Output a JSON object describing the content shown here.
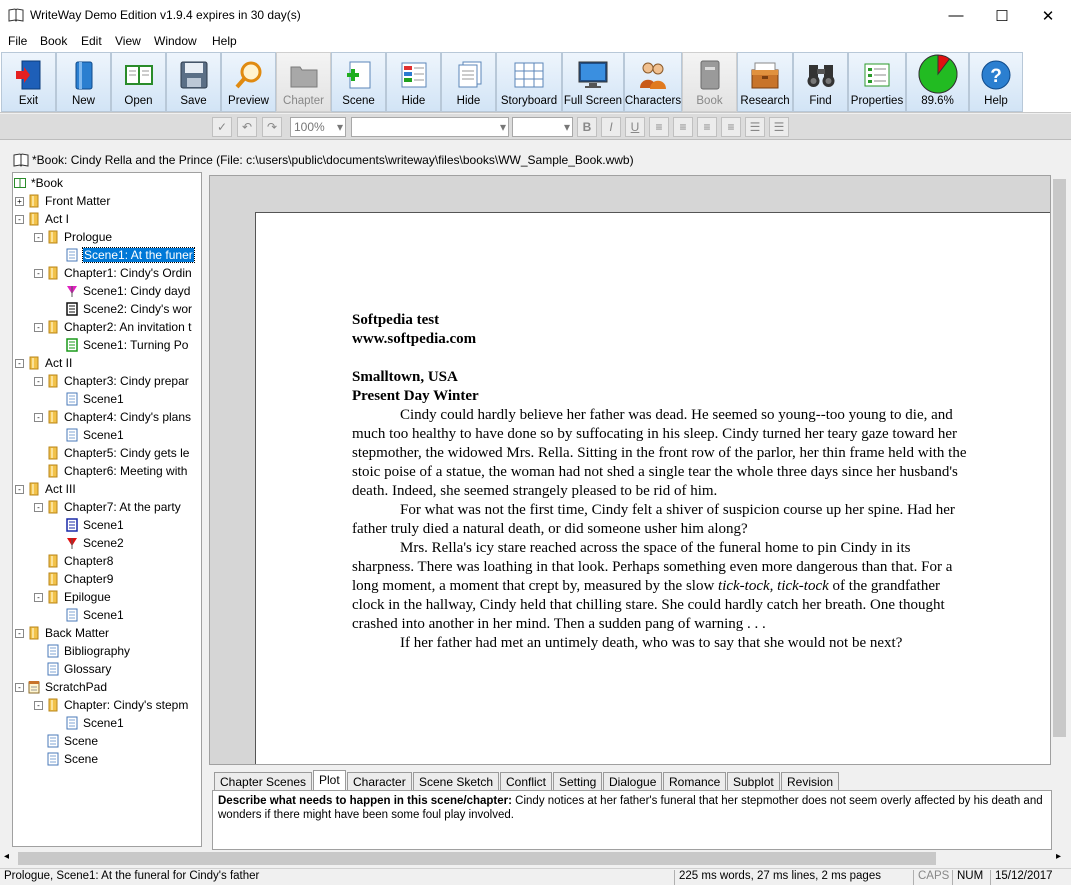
{
  "window": {
    "title": "WriteWay Demo Edition v1.9.4  expires in 30 day(s)",
    "min_glyph": "—",
    "max_glyph": "☐",
    "close_glyph": "✕"
  },
  "menu": [
    "File",
    "Book",
    "Edit",
    "View",
    "Window",
    "Help"
  ],
  "toolbar": [
    {
      "label": "Exit",
      "icon": "exit-door-icon",
      "enabled": true
    },
    {
      "label": "New",
      "icon": "new-book-icon",
      "enabled": true
    },
    {
      "label": "Open",
      "icon": "open-book-icon",
      "enabled": true
    },
    {
      "label": "Save",
      "icon": "floppy-disk-icon",
      "enabled": true
    },
    {
      "label": "Preview",
      "icon": "magnifier-icon",
      "enabled": true
    },
    {
      "label": "Chapter",
      "icon": "folder-icon",
      "enabled": false
    },
    {
      "label": "Scene",
      "icon": "add-scene-icon",
      "enabled": true
    },
    {
      "label": "Hide",
      "icon": "hide-panel-icon",
      "enabled": true
    },
    {
      "label": "Hide",
      "icon": "hide-pages-icon",
      "enabled": true
    },
    {
      "label": "Storyboard",
      "icon": "storyboard-grid-icon",
      "enabled": true
    },
    {
      "label": "Full Screen",
      "icon": "monitor-icon",
      "enabled": true
    },
    {
      "label": "Characters",
      "icon": "people-icon",
      "enabled": true
    },
    {
      "label": "Book",
      "icon": "book-icon",
      "enabled": false
    },
    {
      "label": "Research",
      "icon": "research-box-icon",
      "enabled": true
    },
    {
      "label": "Find",
      "icon": "binoculars-icon",
      "enabled": true
    },
    {
      "label": "Properties",
      "icon": "properties-icon",
      "enabled": true
    },
    {
      "label": "89.6%",
      "icon": "progress-pie-icon",
      "enabled": true
    },
    {
      "label": "Help",
      "icon": "help-icon",
      "enabled": true
    }
  ],
  "progress_fraction": 0.896,
  "colors": {
    "progress_done": "#22bb22",
    "progress_rest": "#e01010",
    "selection": "#0078d7"
  },
  "format": {
    "zoom": "100%",
    "font": "",
    "size": "",
    "bold": "B",
    "italic": "I",
    "underline": "U"
  },
  "doc_title": "*Book: Cindy Rella and the Prince (File: c:\\users\\public\\documents\\writeway\\files\\books\\WW_Sample_Book.wwb)",
  "tree": [
    {
      "label": "*Book",
      "depth": 0,
      "icon": "book",
      "exp": ""
    },
    {
      "label": "Front Matter",
      "depth": 1,
      "icon": "folder",
      "exp": "+"
    },
    {
      "label": "Act I",
      "depth": 1,
      "icon": "folder",
      "exp": "-"
    },
    {
      "label": "Prologue",
      "depth": 2,
      "icon": "folder",
      "exp": "-"
    },
    {
      "label": "Scene1: At the funer",
      "depth": 3,
      "icon": "doc",
      "exp": "",
      "selected": true
    },
    {
      "label": "Chapter1: Cindy's Ordin",
      "depth": 2,
      "icon": "folder",
      "exp": "-"
    },
    {
      "label": "Scene1: Cindy dayd",
      "depth": 3,
      "icon": "flag-magenta",
      "exp": ""
    },
    {
      "label": "Scene2: Cindy's wor",
      "depth": 3,
      "icon": "doc-dark",
      "exp": ""
    },
    {
      "label": "Chapter2: An invitation t",
      "depth": 2,
      "icon": "folder",
      "exp": "-"
    },
    {
      "label": "Scene1: Turning Po",
      "depth": 3,
      "icon": "doc-green",
      "exp": ""
    },
    {
      "label": "Act II",
      "depth": 1,
      "icon": "folder",
      "exp": "-"
    },
    {
      "label": "Chapter3: Cindy prepar",
      "depth": 2,
      "icon": "folder",
      "exp": "-"
    },
    {
      "label": "Scene1",
      "depth": 3,
      "icon": "doc",
      "exp": ""
    },
    {
      "label": "Chapter4: Cindy's plans",
      "depth": 2,
      "icon": "folder",
      "exp": "-"
    },
    {
      "label": "Scene1",
      "depth": 3,
      "icon": "doc",
      "exp": ""
    },
    {
      "label": "Chapter5: Cindy gets le",
      "depth": 2,
      "icon": "folder",
      "exp": ""
    },
    {
      "label": "Chapter6: Meeting with",
      "depth": 2,
      "icon": "folder",
      "exp": ""
    },
    {
      "label": "Act III",
      "depth": 1,
      "icon": "folder",
      "exp": "-"
    },
    {
      "label": "Chapter7: At the party",
      "depth": 2,
      "icon": "folder",
      "exp": "-"
    },
    {
      "label": "Scene1",
      "depth": 3,
      "icon": "doc-blue",
      "exp": ""
    },
    {
      "label": "Scene2",
      "depth": 3,
      "icon": "flag-red",
      "exp": ""
    },
    {
      "label": "Chapter8",
      "depth": 2,
      "icon": "folder",
      "exp": ""
    },
    {
      "label": "Chapter9",
      "depth": 2,
      "icon": "folder",
      "exp": ""
    },
    {
      "label": "Epilogue",
      "depth": 2,
      "icon": "folder",
      "exp": "-"
    },
    {
      "label": "Scene1",
      "depth": 3,
      "icon": "doc",
      "exp": ""
    },
    {
      "label": "Back Matter",
      "depth": 1,
      "icon": "folder",
      "exp": "-"
    },
    {
      "label": "Bibliography",
      "depth": 2,
      "icon": "doc",
      "exp": ""
    },
    {
      "label": "Glossary",
      "depth": 2,
      "icon": "doc",
      "exp": ""
    },
    {
      "label": "ScratchPad",
      "depth": 1,
      "icon": "notepad",
      "exp": "-"
    },
    {
      "label": "Chapter: Cindy's stepm",
      "depth": 2,
      "icon": "folder",
      "exp": "-"
    },
    {
      "label": "Scene1",
      "depth": 3,
      "icon": "doc",
      "exp": ""
    },
    {
      "label": "Scene",
      "depth": 2,
      "icon": "doc",
      "exp": ""
    },
    {
      "label": "Scene",
      "depth": 2,
      "icon": "doc",
      "exp": ""
    }
  ],
  "document": {
    "heading1": "Softpedia test",
    "heading2": "www.softpedia.com",
    "heading3": "Smalltown, USA",
    "heading4": "Present Day Winter",
    "p1": "Cindy could hardly believe her father was dead. He seemed so young--too young to die, and much too healthy to have done so by suffocating in his sleep. Cindy turned her teary gaze toward her stepmother, the widowed Mrs. Rella. Sitting in the front row of the parlor, her thin frame held with the stoic poise of a statue, the woman had not shed a single tear the whole three days since her husband's death. Indeed, she seemed strangely pleased to be rid of him.",
    "p2": "For what was not the first time, Cindy felt a shiver of suspicion course up her spine. Had her father truly died a natural death, or did someone usher him along?",
    "p3a": "Mrs. Rella's icy stare reached across the space of the funeral home to pin Cindy in its sharpness. There was loathing in that look. Perhaps something even more dangerous than that. For a long moment, a moment that crept by, measured by the slow ",
    "p3i": "tick-tock, tick-tock",
    "p3b": " of the grandfather clock in the hallway, Cindy held that chilling stare. She could hardly catch her breath. One thought crashed into another in her mind. Then a sudden pang of warning . . .",
    "p4": "If her father had met an untimely death, who was to say that she would not be next?"
  },
  "tabs": [
    "Chapter Scenes",
    "Plot",
    "Character",
    "Scene Sketch",
    "Conflict",
    "Setting",
    "Dialogue",
    "Romance",
    "Subplot",
    "Revision"
  ],
  "notes": {
    "label": "Describe what needs to happen in this scene/chapter:",
    "text": " Cindy notices at her father's funeral that her stepmother does not seem overly affected by his death and wonders if there might have been some foul play involved."
  },
  "status": {
    "location": "Prologue, Scene1: At the funeral for Cindy's father",
    "counts": "225 ms words, 27 ms lines, 2 ms pages",
    "caps": "CAPS",
    "num": "NUM",
    "date": "15/12/2017"
  }
}
